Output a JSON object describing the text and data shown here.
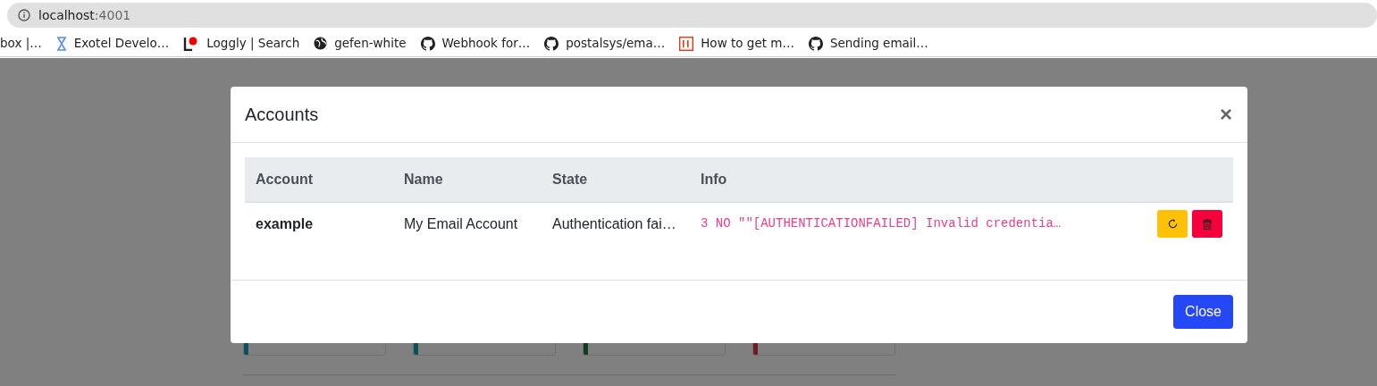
{
  "browser": {
    "address": {
      "host": "localhost",
      "port": ":4001"
    },
    "bookmarks": [
      {
        "kind": "none",
        "label": "box |…"
      },
      {
        "kind": "exotel",
        "label": "Exotel Develo…"
      },
      {
        "kind": "loggly",
        "label": "Loggly | Search"
      },
      {
        "kind": "globe",
        "label": "gefen-white"
      },
      {
        "kind": "github",
        "label": "Webhook for…"
      },
      {
        "kind": "github",
        "label": "postalsys/ema…"
      },
      {
        "kind": "ui",
        "label": "How to get m…"
      },
      {
        "kind": "github",
        "label": "Sending email…"
      }
    ]
  },
  "cards": [
    {
      "color": "#0c515c"
    },
    {
      "color": "#0c515c"
    },
    {
      "color": "#0d3d1d"
    },
    {
      "color": "#6e1b23"
    }
  ],
  "modal": {
    "title": "Accounts",
    "close_glyph": "×",
    "table": {
      "columns": [
        "Account",
        "Name",
        "State",
        "Info"
      ],
      "rows": [
        {
          "account": "example",
          "name": "My Email Account",
          "state": "Authentication fai…",
          "info": "3 NO \"\"[AUTHENTICATIONFAILED] Invalid credentia…",
          "actions": [
            {
              "kind": "reconnect"
            },
            {
              "kind": "delete"
            }
          ]
        }
      ]
    },
    "footer_button": "Close"
  }
}
